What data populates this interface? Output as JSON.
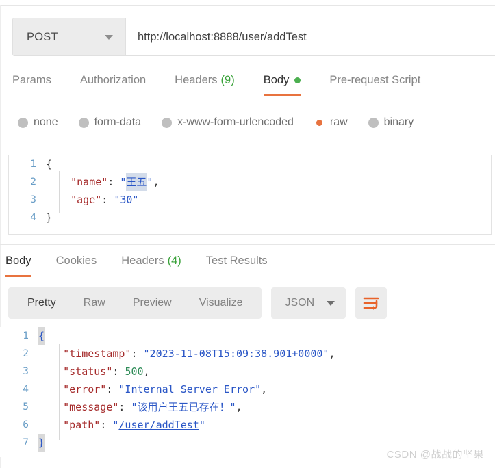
{
  "request": {
    "method": "POST",
    "url": "http://localhost:8888/user/addTest",
    "tabs": [
      {
        "label": "Params",
        "active": false
      },
      {
        "label": "Authorization",
        "active": false
      },
      {
        "label": "Headers",
        "count": "(9)",
        "active": false
      },
      {
        "label": "Body",
        "active": true,
        "dot": true
      },
      {
        "label": "Pre-request Script",
        "active": false
      }
    ],
    "body_types": [
      {
        "label": "none",
        "selected": false
      },
      {
        "label": "form-data",
        "selected": false
      },
      {
        "label": "x-www-form-urlencoded",
        "selected": false
      },
      {
        "label": "raw",
        "selected": true
      },
      {
        "label": "binary",
        "selected": false
      }
    ],
    "body_code": {
      "line1_num": "1",
      "line1_brace": "{",
      "line2_num": "2",
      "line2_indent": "    ",
      "line2_key": "\"name\"",
      "line2_colon": ": ",
      "line2_quote_open": "\"",
      "line2_value": "王五",
      "line2_quote_close": "\"",
      "line2_comma": ",",
      "line3_num": "3",
      "line3_indent": "    ",
      "line3_key": "\"age\"",
      "line3_colon": ": ",
      "line3_value": "\"30\"",
      "line4_num": "4",
      "line4_brace": "}"
    }
  },
  "response": {
    "tabs": [
      {
        "label": "Body",
        "active": true
      },
      {
        "label": "Cookies",
        "active": false
      },
      {
        "label": "Headers",
        "count": "(4)",
        "active": false
      },
      {
        "label": "Test Results",
        "active": false
      }
    ],
    "view_modes": [
      {
        "label": "Pretty",
        "active": true
      },
      {
        "label": "Raw",
        "active": false
      },
      {
        "label": "Preview",
        "active": false
      },
      {
        "label": "Visualize",
        "active": false
      }
    ],
    "format": "JSON",
    "wrap_icon": "word-wrap-icon",
    "body_code": {
      "line1_num": "1",
      "line1_brace": "{",
      "line2_num": "2",
      "line2_indent": "    ",
      "line2_key": "\"timestamp\"",
      "line2_colon": ": ",
      "line2_value": "\"2023-11-08T15:09:38.901+0000\"",
      "line2_comma": ",",
      "line3_num": "3",
      "line3_indent": "    ",
      "line3_key": "\"status\"",
      "line3_colon": ": ",
      "line3_value": "500",
      "line3_comma": ",",
      "line4_num": "4",
      "line4_indent": "    ",
      "line4_key": "\"error\"",
      "line4_colon": ": ",
      "line4_value": "\"Internal Server Error\"",
      "line4_comma": ",",
      "line5_num": "5",
      "line5_indent": "    ",
      "line5_key": "\"message\"",
      "line5_colon": ": ",
      "line5_value": "\"该用户王五已存在！\"",
      "line5_comma": ",",
      "line6_num": "6",
      "line6_indent": "    ",
      "line6_key": "\"path\"",
      "line6_colon": ": ",
      "line6_quote_open": "\"",
      "line6_value": "/user/addTest",
      "line6_quote_close": "\"",
      "line7_num": "7",
      "line7_brace": "}"
    }
  },
  "watermark": "CSDN @战战的坚果",
  "colors": {
    "accent": "#e8733f",
    "success": "#3aa23a",
    "key": "#a52a2a",
    "string": "#2a56c6",
    "number": "#2e8b57",
    "gutter": "#6a9ec7",
    "selection": "#d3dcea"
  }
}
